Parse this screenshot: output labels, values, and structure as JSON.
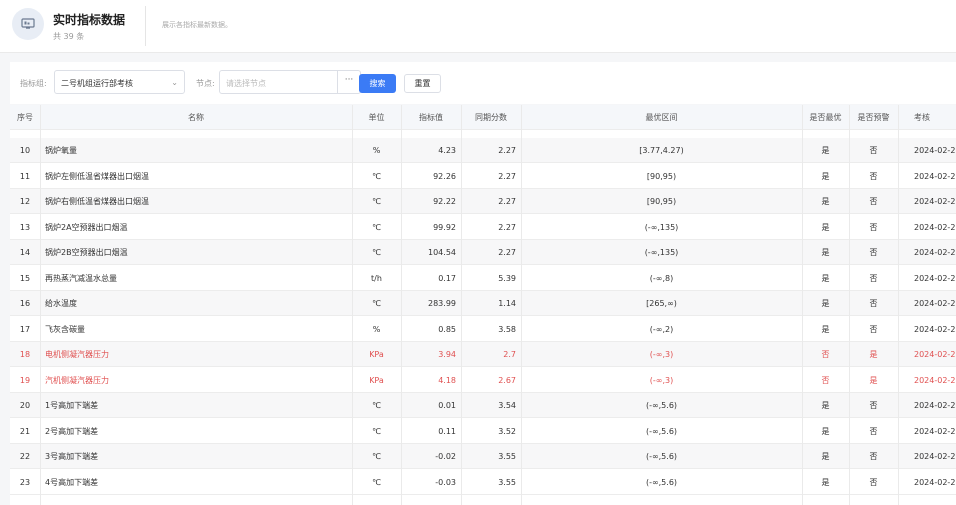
{
  "header": {
    "title": "实时指标数据",
    "count": "共 39 条",
    "description": "展示各指标最新数据。"
  },
  "filters": {
    "indicator_label": "指标组:",
    "indicator_value": "二号机组运行部考核",
    "node_label": "节点:",
    "node_placeholder": "请选择节点",
    "node_button": "···",
    "search_label": "搜索",
    "reset_label": "重置"
  },
  "table": {
    "columns": [
      "序号",
      "名称",
      "单位",
      "指标值",
      "同期分数",
      "最优区间",
      "是否最优",
      "是否预警",
      "考核"
    ],
    "rows": [
      {
        "idx": "10",
        "name": "锅炉氧量",
        "unit": "%",
        "value": "4.23",
        "score": "2.27",
        "range": "[3.77,4.27)",
        "optimal": "是",
        "warning": "否",
        "date": "2024-02-2",
        "alert": false
      },
      {
        "idx": "11",
        "name": "锅炉左侧低温省煤器出口烟温",
        "unit": "℃",
        "value": "92.26",
        "score": "2.27",
        "range": "[90,95)",
        "optimal": "是",
        "warning": "否",
        "date": "2024-02-2",
        "alert": false
      },
      {
        "idx": "12",
        "name": "锅炉右侧低温省煤器出口烟温",
        "unit": "℃",
        "value": "92.22",
        "score": "2.27",
        "range": "[90,95)",
        "optimal": "是",
        "warning": "否",
        "date": "2024-02-2",
        "alert": false
      },
      {
        "idx": "13",
        "name": "锅炉2A空预器出口烟温",
        "unit": "℃",
        "value": "99.92",
        "score": "2.27",
        "range": "(-∞,135)",
        "optimal": "是",
        "warning": "否",
        "date": "2024-02-2",
        "alert": false
      },
      {
        "idx": "14",
        "name": "锅炉2B空预器出口烟温",
        "unit": "℃",
        "value": "104.54",
        "score": "2.27",
        "range": "(-∞,135)",
        "optimal": "是",
        "warning": "否",
        "date": "2024-02-2",
        "alert": false
      },
      {
        "idx": "15",
        "name": "再热蒸汽减温水总量",
        "unit": "t/h",
        "value": "0.17",
        "score": "5.39",
        "range": "(-∞,8)",
        "optimal": "是",
        "warning": "否",
        "date": "2024-02-2",
        "alert": false
      },
      {
        "idx": "16",
        "name": "给水温度",
        "unit": "℃",
        "value": "283.99",
        "score": "1.14",
        "range": "[265,∞)",
        "optimal": "是",
        "warning": "否",
        "date": "2024-02-2",
        "alert": false
      },
      {
        "idx": "17",
        "name": "飞灰含碳量",
        "unit": "%",
        "value": "0.85",
        "score": "3.58",
        "range": "(-∞,2)",
        "optimal": "是",
        "warning": "否",
        "date": "2024-02-2",
        "alert": false
      },
      {
        "idx": "18",
        "name": "电机侧凝汽器压力",
        "unit": "KPa",
        "value": "3.94",
        "score": "2.7",
        "range": "(-∞,3)",
        "optimal": "否",
        "warning": "是",
        "date": "2024-02-2",
        "alert": true
      },
      {
        "idx": "19",
        "name": "汽机侧凝汽器压力",
        "unit": "KPa",
        "value": "4.18",
        "score": "2.67",
        "range": "(-∞,3)",
        "optimal": "否",
        "warning": "是",
        "date": "2024-02-2",
        "alert": true
      },
      {
        "idx": "20",
        "name": "1号高加下端差",
        "unit": "℃",
        "value": "0.01",
        "score": "3.54",
        "range": "(-∞,5.6)",
        "optimal": "是",
        "warning": "否",
        "date": "2024-02-2",
        "alert": false
      },
      {
        "idx": "21",
        "name": "2号高加下端差",
        "unit": "℃",
        "value": "0.11",
        "score": "3.52",
        "range": "(-∞,5.6)",
        "optimal": "是",
        "warning": "否",
        "date": "2024-02-2",
        "alert": false
      },
      {
        "idx": "22",
        "name": "3号高加下端差",
        "unit": "℃",
        "value": "-0.02",
        "score": "3.55",
        "range": "(-∞,5.6)",
        "optimal": "是",
        "warning": "否",
        "date": "2024-02-2",
        "alert": false
      },
      {
        "idx": "23",
        "name": "4号高加下端差",
        "unit": "℃",
        "value": "-0.03",
        "score": "3.55",
        "range": "(-∞,5.6)",
        "optimal": "是",
        "warning": "否",
        "date": "2024-02-2",
        "alert": false
      }
    ]
  },
  "colors": {
    "accent": "#3b7bf5",
    "alert": "#e05050"
  }
}
